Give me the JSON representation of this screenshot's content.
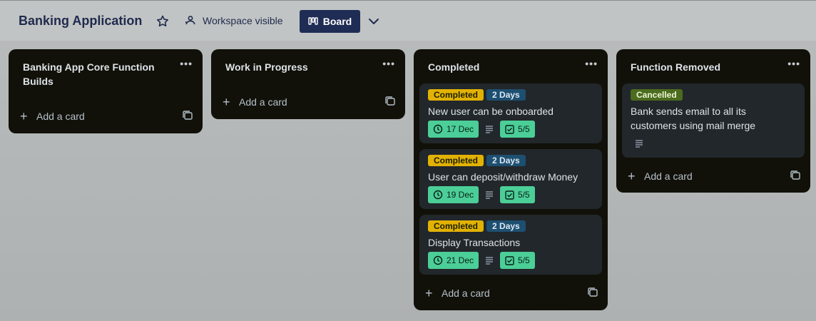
{
  "header": {
    "board_title": "Banking Application",
    "visibility": "Workspace visible",
    "view_button": "Board"
  },
  "lists": [
    {
      "title": "Banking App Core Function Builds",
      "add_card": "Add a card"
    },
    {
      "title": "Work in Progress",
      "add_card": "Add a card"
    },
    {
      "title": "Completed",
      "add_card": "Add a card",
      "cards": [
        {
          "labels": [
            "Completed",
            "2 Days"
          ],
          "title": "New user can be onboarded",
          "due": "17 Dec",
          "checklist": "5/5"
        },
        {
          "labels": [
            "Completed",
            "2 Days"
          ],
          "title": "User can deposit/withdraw Money",
          "due": "19 Dec",
          "checklist": "5/5"
        },
        {
          "labels": [
            "Completed",
            "2 Days"
          ],
          "title": "Display Transactions",
          "due": "21 Dec",
          "checklist": "5/5"
        }
      ]
    },
    {
      "title": "Function Removed",
      "add_card": "Add a card",
      "cards": [
        {
          "labels": [
            "Cancelled"
          ],
          "title": "Bank sends email to all its customers using mail merge"
        }
      ]
    }
  ],
  "colors": {
    "label_yellow": "#e2b203",
    "label_blue": "#1d4f70",
    "label_green": "#4c6b1f",
    "badge_green": "#4bce97",
    "list_bg": "#111109"
  },
  "icons": [
    "star-icon",
    "workspace-icon",
    "board-icon",
    "chevron-down-icon",
    "more-icon",
    "plus-icon",
    "template-icon",
    "clock-icon",
    "description-icon",
    "checklist-icon"
  ]
}
